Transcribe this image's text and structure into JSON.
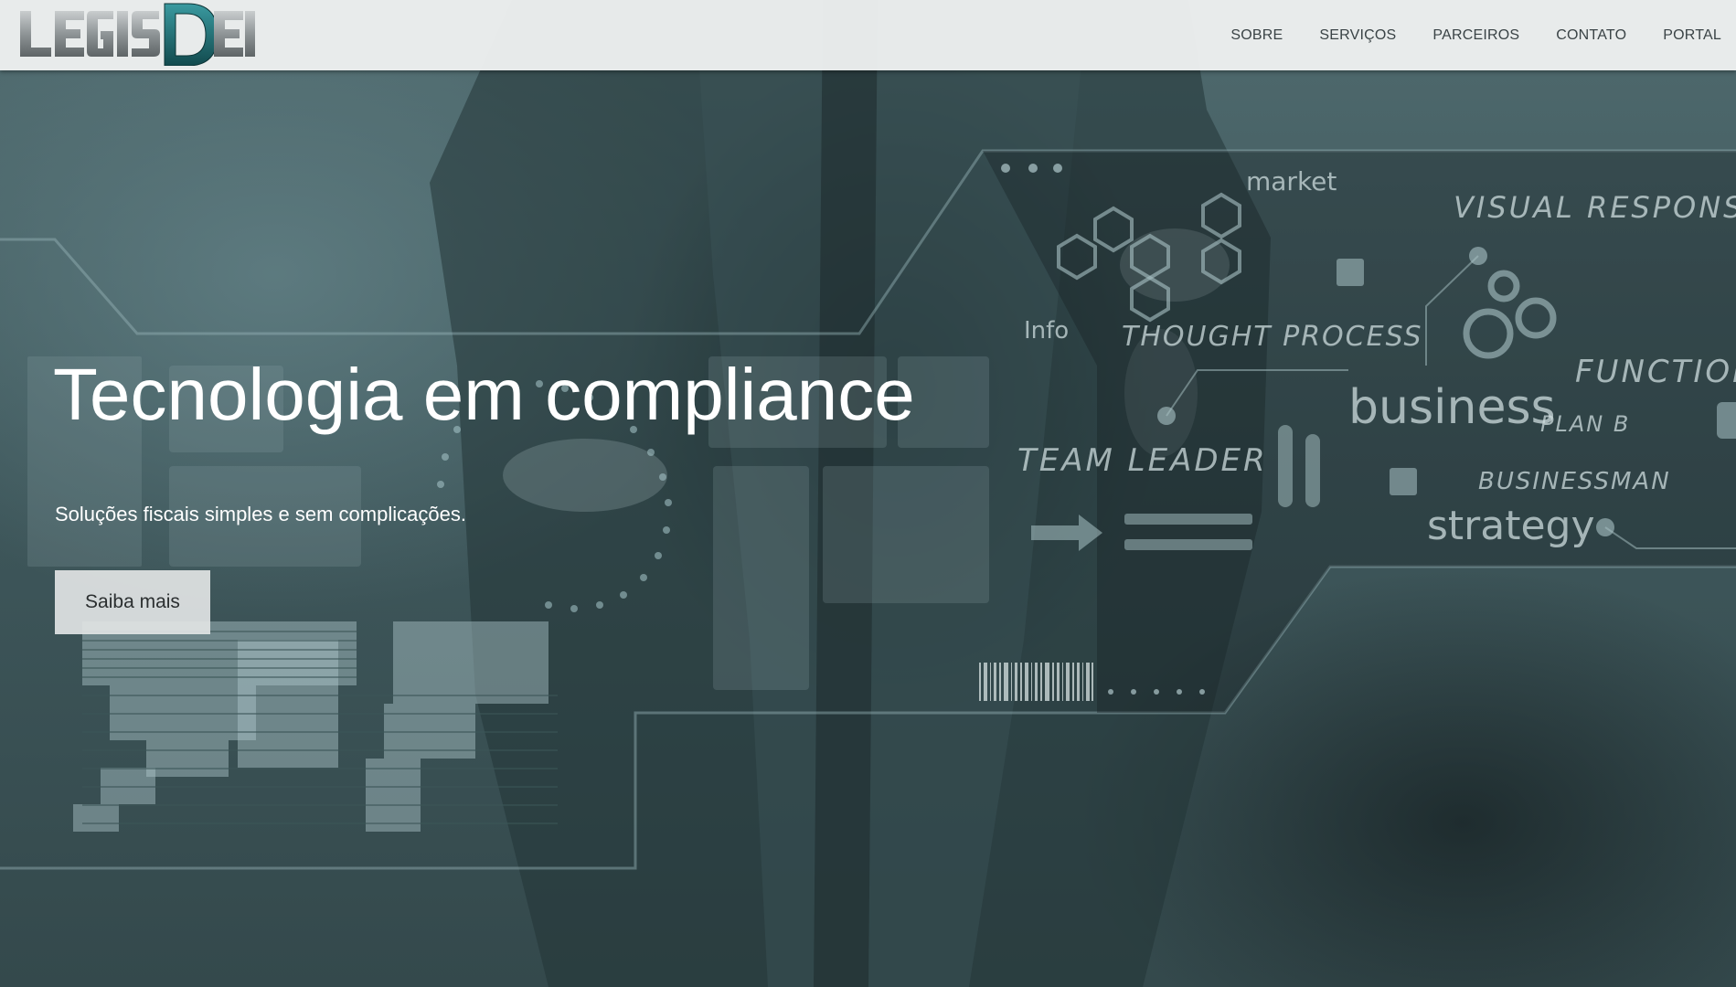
{
  "header": {
    "logo_text": "LEGISDEI",
    "nav": [
      {
        "label": "SOBRE"
      },
      {
        "label": "SERVIÇOS"
      },
      {
        "label": "PARCEIROS"
      },
      {
        "label": "CONTATO"
      },
      {
        "label": "PORTAL"
      }
    ]
  },
  "hero": {
    "title": "Tecnologia em compliance",
    "subtitle": "Soluções fiscais simples e sem complicações.",
    "cta_label": "Saiba mais",
    "background_words": [
      "market",
      "VISUAL RESPONSE",
      "Info",
      "THOUGHT PROCESS",
      "FUNCTION",
      "business",
      "PLAN B",
      "TEAM LEADER",
      "BUSINESSMAN",
      "strategy"
    ]
  },
  "colors": {
    "navbar_bg": "#eef0f0",
    "nav_text": "#3a4346",
    "hero_tint": "#4f6a6e",
    "logo_gray": "#8f9597",
    "logo_teal": "#1f6f73",
    "cta_bg": "#e1e4e4"
  }
}
